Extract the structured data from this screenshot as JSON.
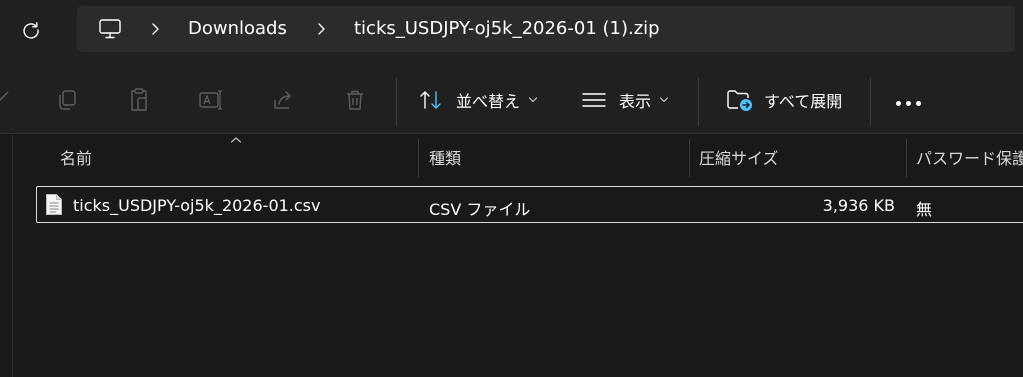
{
  "address_bar": {
    "breadcrumbs": [
      "Downloads",
      "ticks_USDJPY-oj5k_2026-01 (1).zip"
    ]
  },
  "command_bar": {
    "sort_label": "並べ替え",
    "view_label": "表示",
    "expand_all_label": "すべて展開"
  },
  "columns": {
    "name": "名前",
    "type": "種類",
    "compressed_size": "圧縮サイズ",
    "password_protected": "パスワード保護"
  },
  "files": [
    {
      "name": "ticks_USDJPY-oj5k_2026-01.csv",
      "type": "CSV ファイル",
      "compressed_size": "3,936 KB",
      "password_protected": "無"
    }
  ],
  "colors": {
    "background": "#191919",
    "toolbar": "#202020",
    "address_box": "#2b2b2b",
    "selection_border": "#d9d9d9",
    "accent": "#4cc2ff"
  }
}
